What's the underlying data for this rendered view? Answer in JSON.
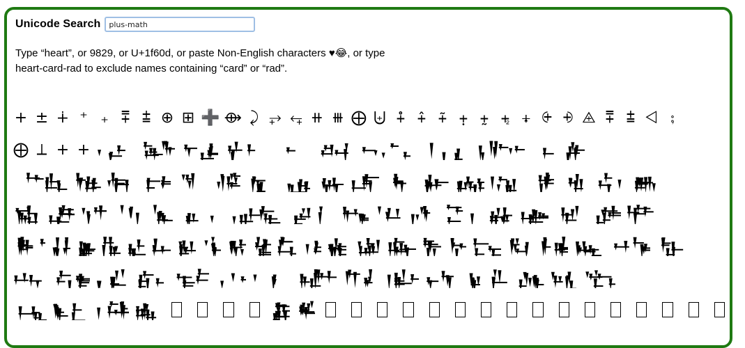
{
  "header": {
    "title": "Unicode Search",
    "search_value": "plus-math"
  },
  "help": {
    "line1": "Type “heart”, or 9829, or U+1f60d, or paste Non-English characters ♥😂, or type",
    "line2": "heart-card-rad to exclude names containing “card” or “rad”."
  },
  "symbols_row1": [
    "+",
    "±",
    "∔",
    "⁺",
    "₊",
    "⩱",
    "⩲",
    "⊕",
    "⊞",
    "➕",
    "⟴",
    "⤸",
    "⥅",
    "⥆",
    "⧺",
    "⧻",
    "⨁",
    "⨄",
    "⨢",
    "⨣",
    "⨤",
    "⨥",
    "⨦",
    "⨧",
    "⨨",
    "⨭",
    "⨮",
    "⨹",
    "⩱",
    "⩲",
    "⨞",
    "⨟"
  ],
  "symbols_row2_start": [
    "⨁",
    "⟂",
    "+",
    "+"
  ]
}
